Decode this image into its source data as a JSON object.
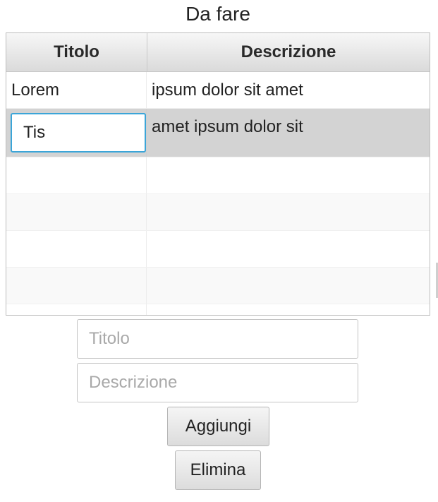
{
  "window": {
    "title": "Da fare"
  },
  "table": {
    "columns": [
      "Titolo",
      "Descrizione"
    ],
    "rows": [
      {
        "titolo": "Lorem",
        "descrizione": "ipsum dolor sit amet"
      },
      {
        "titolo": "Tis",
        "descrizione": "amet ipsum dolor sit",
        "selected": true,
        "editing": true
      }
    ],
    "empty_rows": 5
  },
  "form": {
    "titolo_placeholder": "Titolo",
    "descrizione_placeholder": "Descrizione",
    "titolo_value": "",
    "descrizione_value": ""
  },
  "buttons": {
    "add_label": "Aggiungi",
    "delete_label": "Elimina"
  },
  "colors": {
    "selection": "#d3d3d3",
    "focus": "#3ba5d8"
  }
}
